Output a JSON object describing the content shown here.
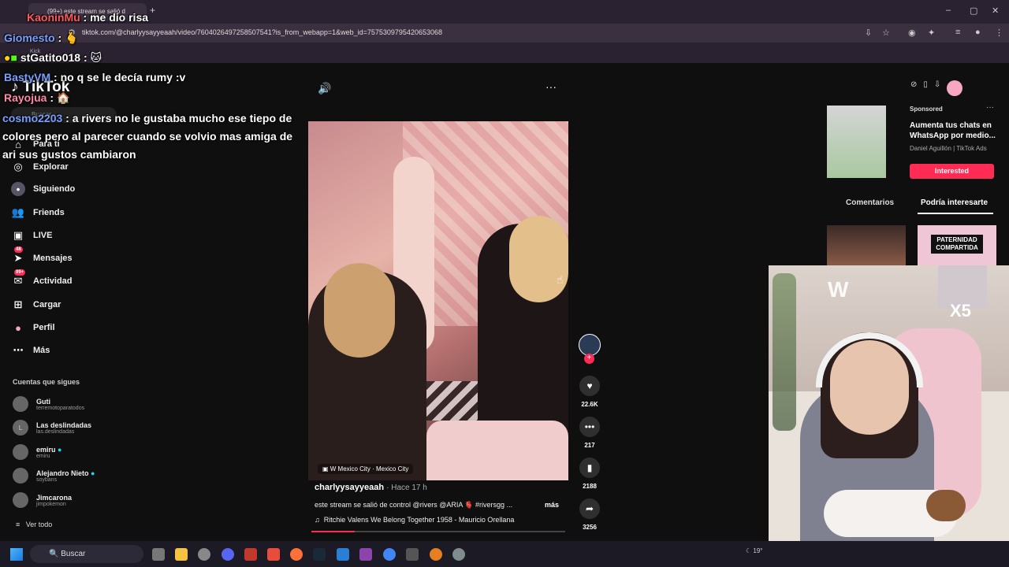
{
  "browser": {
    "tab_title": "(99+) este stream se salió d",
    "url": "tiktok.com/@charlyysayyeaah/video/7604026497258507541?is_from_webapp=1&web_id=7575309795420653068",
    "bookmark_label": "Kick"
  },
  "tiktok": {
    "logo": "TikTok",
    "search_placeholder": "Buscar",
    "nav": [
      {
        "label": "Para ti",
        "icon": "home-icon"
      },
      {
        "label": "Explorar",
        "icon": "compass-icon"
      },
      {
        "label": "Siguiendo",
        "icon": "following-avatar-icon"
      },
      {
        "label": "Friends",
        "icon": "friends-icon"
      },
      {
        "label": "LIVE",
        "icon": "live-icon"
      },
      {
        "label": "Mensajes",
        "icon": "messages-icon",
        "badge": "48"
      },
      {
        "label": "Actividad",
        "icon": "activity-icon",
        "badge": "99+"
      },
      {
        "label": "Cargar",
        "icon": "upload-icon"
      },
      {
        "label": "Perfil",
        "icon": "profile-icon"
      },
      {
        "label": "Más",
        "icon": "more-icon"
      }
    ],
    "following_header": "Cuentas que sigues",
    "following": [
      {
        "name": "Guti",
        "handle": "terremotoparatodos",
        "initial": ""
      },
      {
        "name": "Las deslindadas",
        "handle": "las.deslindadas",
        "initial": "L"
      },
      {
        "name": "emiru",
        "handle": "emiru",
        "verified": true,
        "initial": ""
      },
      {
        "name": "Alejandro Nieto",
        "handle": "soybans",
        "verified": true,
        "initial": ""
      },
      {
        "name": "Jimcarona",
        "handle": "jimpokemon",
        "initial": ""
      }
    ],
    "see_all": "Ver todo",
    "video": {
      "location": "W Mexico City · Mexico City",
      "author": "charlyysayyeaah",
      "posted": "· Hace 17 h",
      "description": "este stream se salió de control @rivers @ARIA 🫀 #riversgg ...",
      "more_label": "más",
      "music": "Ritchie Valens We Belong Together 1958 - Mauricio Orellana",
      "progress": 0.17
    },
    "actions": {
      "likes": "22.6K",
      "comments": "217",
      "saves": "2188",
      "shares": "3256"
    },
    "ad": {
      "sponsored": "Sponsored",
      "title": "Aumenta tus chats en WhatsApp por medio...",
      "source": "Daniel Aguillón | TikTok Ads",
      "button": "Interested"
    },
    "right_tabs": [
      "Comentarios",
      "Podría interesarte"
    ],
    "suggest_label": "PATERNIDAD COMPARTIDA"
  },
  "webcam": {
    "logo": "W",
    "multiplier": "X5"
  },
  "chat": [
    {
      "user": "KaoninMu",
      "text": ": me dio risa"
    },
    {
      "user": "Giomesto",
      "text": ": 🫰"
    },
    {
      "user": "stGatito018",
      "text": ": 🐱"
    },
    {
      "user": "BastyVM",
      "text": ": no q se le decía rumy :v"
    },
    {
      "user": "Rayojua",
      "text": ": 🏠"
    },
    {
      "user": "cosmo2203",
      "text": ": a rivers no le gustaba mucho ese tiepo de colores pero al parecer cuando se volvio mas amiga de ari sus gustos cambiaron"
    }
  ],
  "taskbar": {
    "search_label": "Buscar",
    "weather": "19°"
  },
  "colors": {
    "accent": "#fe2c55",
    "chat_user": "#7aa0ff"
  }
}
